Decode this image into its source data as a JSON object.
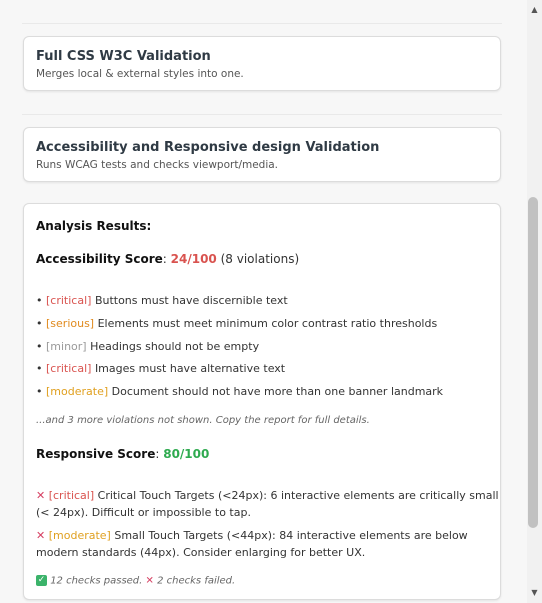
{
  "tools": [
    {
      "title": "Full CSS W3C Validation",
      "desc": "Merges local & external styles into one."
    },
    {
      "title": "Accessibility and Responsive design Validation",
      "desc": "Runs WCAG tests and checks viewport/media."
    }
  ],
  "results": {
    "heading": "Analysis Results:",
    "acc_label": "Accessibility Score",
    "acc_score": "24/100",
    "acc_violations": "(8 violations)",
    "violations": [
      {
        "severity": "[critical]",
        "text": "Buttons must have discernible text"
      },
      {
        "severity": "[serious]",
        "text": "Elements must meet minimum color contrast ratio thresholds"
      },
      {
        "severity": "[minor]",
        "text": "Headings should not be empty"
      },
      {
        "severity": "[critical]",
        "text": "Images must have alternative text"
      },
      {
        "severity": "[moderate]",
        "text": "Document should not have more than one banner landmark"
      }
    ],
    "more_note": "...and 3 more violations not shown. Copy the report for full details.",
    "resp_label": "Responsive Score",
    "resp_score": "80/100",
    "checks": [
      {
        "severity": "[critical]",
        "line1": "Critical Touch Targets (<24px): 6 interactive elements are critically small",
        "line2": "(< 24px). Difficult or impossible to tap."
      },
      {
        "severity": "[moderate]",
        "line1": "Small Touch Targets (<44px): 84 interactive elements are below",
        "line2": "modern standards (44px). Consider enlarging for better UX."
      }
    ],
    "passed": "12 checks passed.",
    "failed": "2 checks failed."
  }
}
